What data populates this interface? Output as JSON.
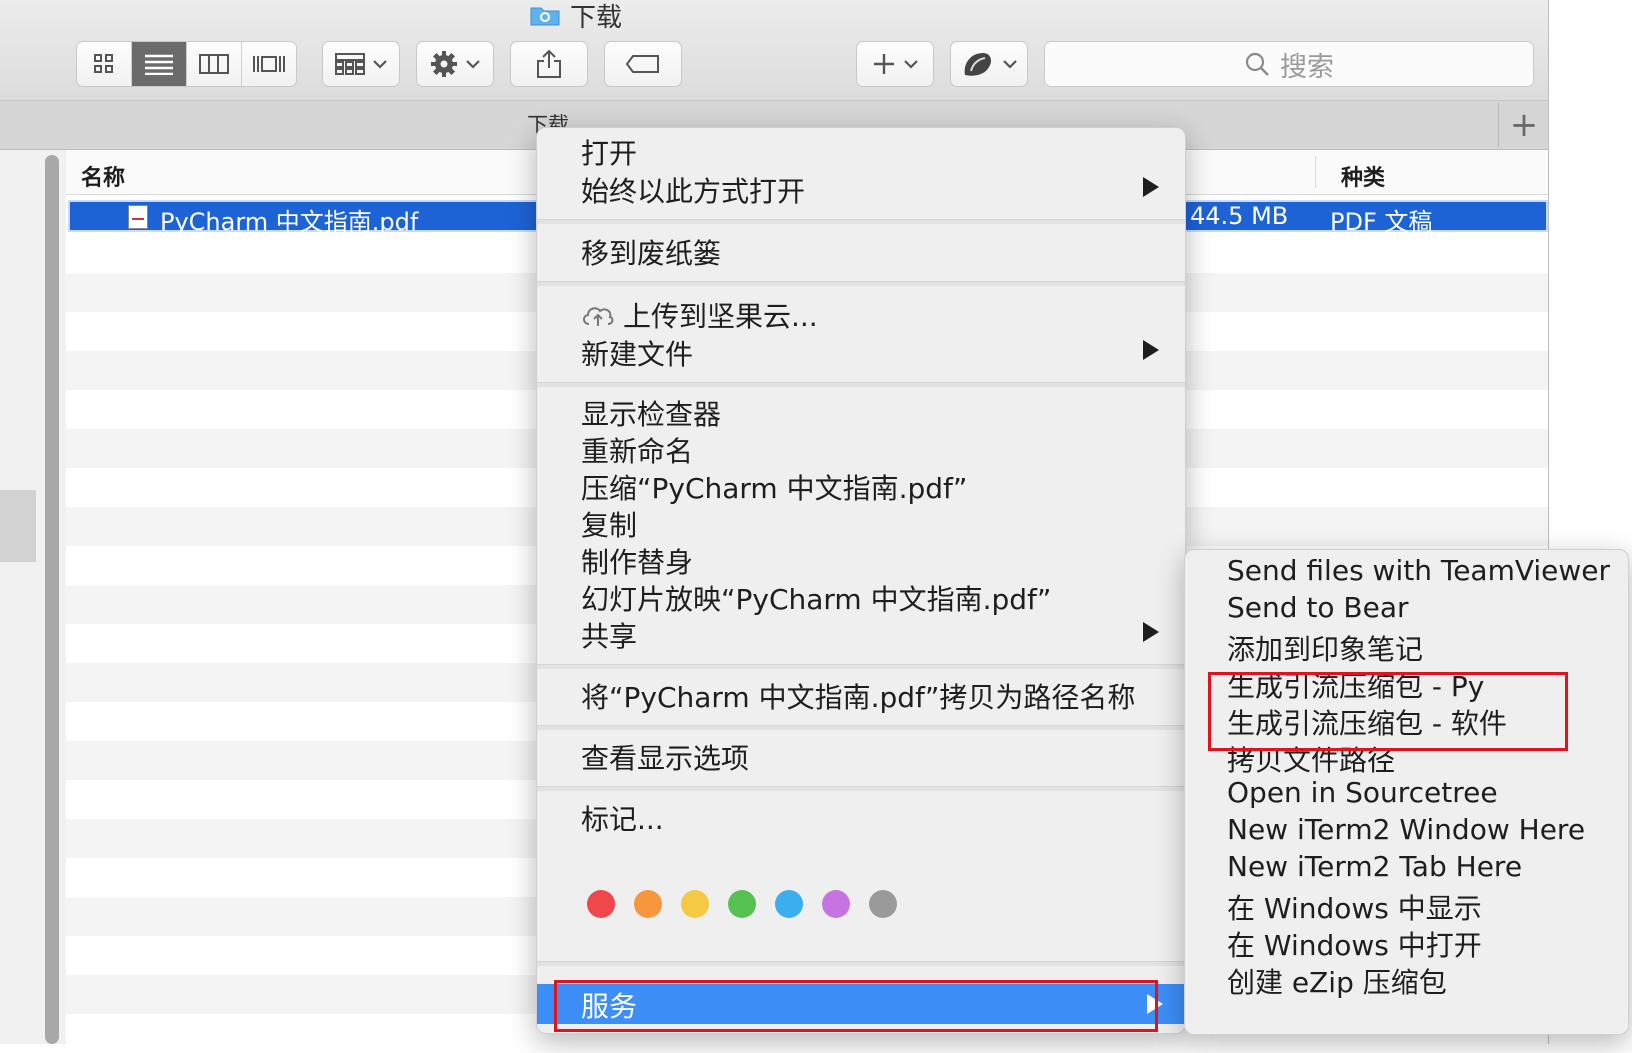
{
  "window": {
    "title": "下载",
    "tab_title": "下载"
  },
  "toolbar": {
    "view_buttons": [
      "icon-view",
      "list-view",
      "column-view",
      "cover-flow-view"
    ],
    "search_placeholder": "搜索"
  },
  "list": {
    "columns": {
      "name": "名称",
      "kind": "种类"
    },
    "selected_file": {
      "name": "PyCharm 中文指南.pdf",
      "size": "44.5 MB",
      "kind": "PDF 文稿"
    }
  },
  "context_menu": {
    "open": "打开",
    "open_with": "始终以此方式打开",
    "move_to_trash": "移到废纸篓",
    "upload": "上传到坚果云...",
    "new_file": "新建文件",
    "show_inspector": "显示检查器",
    "rename": "重新命名",
    "compress": "压缩“PyCharm 中文指南.pdf”",
    "duplicate": "复制",
    "make_alias": "制作替身",
    "slideshow": "幻灯片放映“PyCharm 中文指南.pdf”",
    "share": "共享",
    "copy_path": "将“PyCharm 中文指南.pdf”拷贝为路径名称",
    "view_options": "查看显示选项",
    "tags": "标记...",
    "tag_colors": [
      "#f2474a",
      "#f7963c",
      "#f5c944",
      "#55c150",
      "#3aaeee",
      "#c873e2",
      "#9a9a9a"
    ],
    "services": "服务",
    "highlight_color": "#3d8ef7"
  },
  "services_menu": {
    "items": [
      "Send files with TeamViewer",
      "Send to Bear",
      "添加到印象笔记",
      "生成引流压缩包 - Py",
      "生成引流压缩包 - 软件",
      "拷贝文件路径",
      "Open in Sourcetree",
      "New iTerm2 Window Here",
      "New iTerm2 Tab Here",
      "在 Windows 中显示",
      "在 Windows 中打开",
      "创建 eZip 压缩包"
    ]
  },
  "annotation_color": "#e0141e"
}
